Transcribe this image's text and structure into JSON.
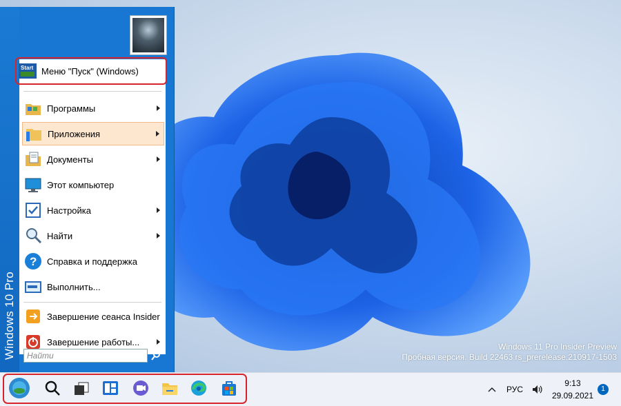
{
  "desktop": {
    "watermark_line1": "Windows 11 Pro Insider Preview",
    "watermark_line2": "Пробная версия. Build 22463.rs_prerelease.210917-1503"
  },
  "start_menu": {
    "side_banner": "Windows 10 Pro",
    "items": [
      {
        "label": "Меню \"Пуск\" (Windows)",
        "icon": "start-menu-icon",
        "submenu": false
      },
      {
        "label": "Программы",
        "icon": "programs-folder-icon",
        "submenu": true
      },
      {
        "label": "Приложения",
        "icon": "apps-folder-icon",
        "submenu": true
      },
      {
        "label": "Документы",
        "icon": "documents-icon",
        "submenu": true
      },
      {
        "label": "Этот компьютер",
        "icon": "computer-icon",
        "submenu": false
      },
      {
        "label": "Настройка",
        "icon": "settings-icon",
        "submenu": true
      },
      {
        "label": "Найти",
        "icon": "search-icon",
        "submenu": true
      },
      {
        "label": "Справка и поддержка",
        "icon": "help-icon",
        "submenu": false
      },
      {
        "label": "Выполнить...",
        "icon": "run-icon",
        "submenu": false
      },
      {
        "label": "Завершение сеанса Insider",
        "icon": "logoff-icon",
        "submenu": false
      },
      {
        "label": "Завершение работы...",
        "icon": "shutdown-icon",
        "submenu": true
      }
    ],
    "search_placeholder": "Найти"
  },
  "taskbar": {
    "icons": [
      "start-button-icon",
      "search-icon",
      "task-view-icon",
      "widgets-icon",
      "chat-icon",
      "file-explorer-icon",
      "edge-icon",
      "store-icon"
    ],
    "language": "РУС",
    "time": "9:13",
    "date": "29.09.2021",
    "notification_count": "1"
  },
  "colors": {
    "accent": "#1877d2",
    "highlight": "#fde7cf",
    "callout": "#d8232a"
  }
}
